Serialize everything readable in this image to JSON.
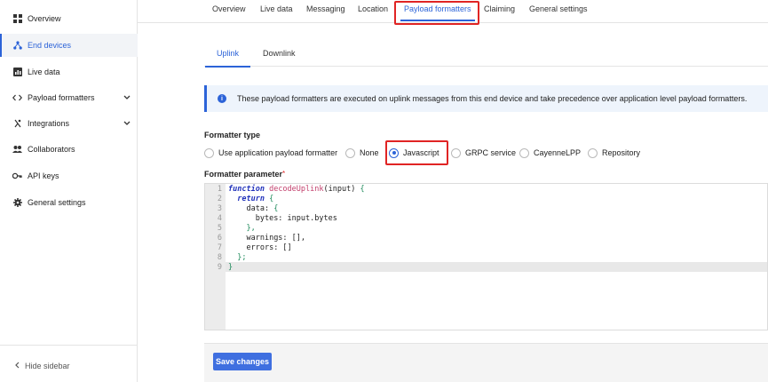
{
  "sidebar": {
    "items": [
      {
        "label": "Overview",
        "icon": "grid-icon"
      },
      {
        "label": "End devices",
        "icon": "device-tree-icon",
        "active": true
      },
      {
        "label": "Live data",
        "icon": "chart-icon"
      },
      {
        "label": "Payload formatters",
        "icon": "code-icon"
      },
      {
        "label": "Integrations",
        "icon": "integrations-icon"
      },
      {
        "label": "Collaborators",
        "icon": "people-icon"
      },
      {
        "label": "API keys",
        "icon": "key-icon"
      },
      {
        "label": "General settings",
        "icon": "gear-icon"
      }
    ],
    "hide_label": "Hide sidebar"
  },
  "top_tabs": [
    "Overview",
    "Live data",
    "Messaging",
    "Location",
    "Payload formatters",
    "Claiming",
    "General settings"
  ],
  "sub_tabs": [
    "Uplink",
    "Downlink"
  ],
  "notice": "These payload formatters are executed on uplink messages from this end device and take precedence over application level payload formatters.",
  "formatter_type": {
    "label": "Formatter type",
    "options": [
      "Use application payload formatter",
      "None",
      "Javascript",
      "GRPC service",
      "CayenneLPP",
      "Repository"
    ],
    "selected": "Javascript"
  },
  "formatter_parameter": {
    "label": "Formatter parameter",
    "required_mark": "*"
  },
  "code": {
    "line_numbers": [
      "1",
      "2",
      "3",
      "4",
      "5",
      "6",
      "7",
      "8",
      "9"
    ],
    "l1": {
      "kw": "function",
      "fn": "decodeUplink",
      "rest": "(input) ",
      "brace": "{"
    },
    "l2": {
      "kw": "return",
      "brace": "{"
    },
    "l3": {
      "text": "data: ",
      "brace": "{"
    },
    "l4": {
      "text": "bytes: input.bytes"
    },
    "l5": {
      "brace": "},"
    },
    "l6": {
      "text": "warnings: [],"
    },
    "l7": {
      "text": "errors: []"
    },
    "l8": {
      "brace": "};"
    },
    "l9": {
      "brace": "}"
    }
  },
  "save_label": "Save changes",
  "colors": {
    "accent": "#2c63d8",
    "highlight": "#e02424"
  }
}
